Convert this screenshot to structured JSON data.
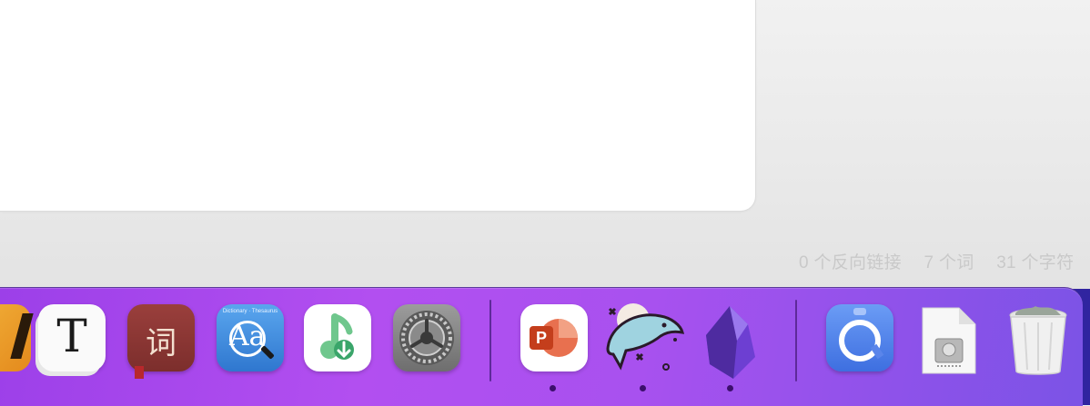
{
  "status_bar": {
    "backlinks": "0 个反向链接",
    "words": "7 个词",
    "chars": "31 个字符"
  },
  "dock": {
    "items": [
      {
        "name": "partial-app",
        "icon": "partial-app-icon"
      },
      {
        "name": "Typora",
        "icon": "typora-icon",
        "glyph": "T"
      },
      {
        "name": "词典 App",
        "icon": "ci-dictionary-icon",
        "glyph": "词"
      },
      {
        "name": "Dictionary",
        "icon": "dictionary-icon",
        "caption": "Dictionary · Thesaurus",
        "glyph": "Aa"
      },
      {
        "name": "Music Downloader",
        "icon": "music-download-icon"
      },
      {
        "name": "System Settings",
        "icon": "gear-icon"
      },
      {
        "name": "PowerPoint",
        "icon": "powerpoint-icon",
        "glyph": "P",
        "running": true
      },
      {
        "name": "MySQL / Dolphin",
        "icon": "dolphin-icon",
        "running": true
      },
      {
        "name": "Obsidian",
        "icon": "obsidian-icon",
        "running": true
      },
      {
        "name": "Backup",
        "icon": "backup-icon"
      },
      {
        "name": "Disk Document",
        "icon": "disk-document-icon"
      },
      {
        "name": "Trash",
        "icon": "trash-icon"
      }
    ]
  },
  "colors": {
    "dock_gradient_start": "#9b3fe8",
    "dock_gradient_end": "#7b53e6",
    "running_dot": "#3c0f6c"
  }
}
